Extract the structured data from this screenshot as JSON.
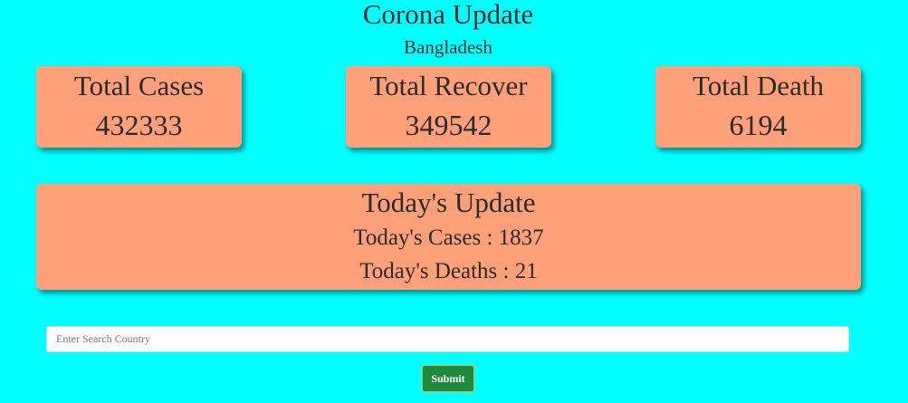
{
  "header": {
    "title": "Corona Update",
    "country": "Bangladesh"
  },
  "stats": {
    "cases": {
      "label": "Total Cases",
      "value": "432333"
    },
    "recover": {
      "label": "Total Recover",
      "value": "349542"
    },
    "death": {
      "label": "Total Death",
      "value": "6194"
    }
  },
  "today": {
    "heading": "Today's Update",
    "cases_line": "Today's Cases : 1837",
    "deaths_line": "Today's Deaths : 21"
  },
  "search": {
    "placeholder": "Enter Search Country",
    "value": "",
    "submit_label": "Submit"
  },
  "colors": {
    "background": "#00ffff",
    "card": "#ffa07a",
    "submit": "#1f8a3a"
  }
}
